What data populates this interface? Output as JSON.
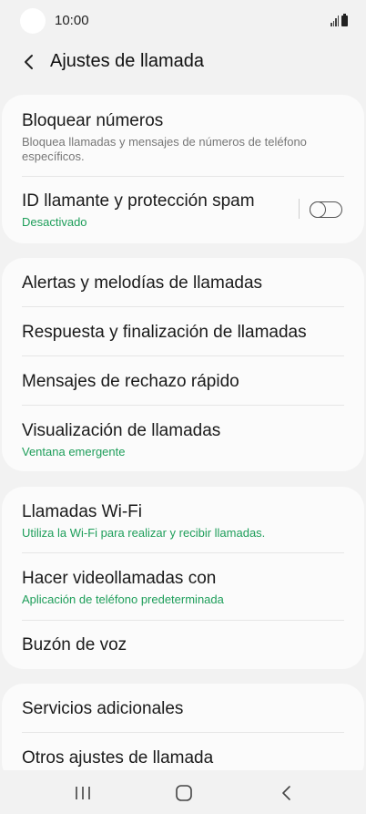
{
  "status": {
    "time": "10:00"
  },
  "header": {
    "title": "Ajustes de llamada"
  },
  "groups": [
    {
      "items": [
        {
          "title": "Bloquear números",
          "subtitle": "Bloquea llamadas y mensajes de números de teléfono específicos."
        },
        {
          "title": "ID llamante y protección spam",
          "subtitle": "Desactivado",
          "toggle": "off"
        }
      ]
    },
    {
      "items": [
        {
          "title": "Alertas y melodías de llamadas"
        },
        {
          "title": "Respuesta y finalización de llamadas"
        },
        {
          "title": "Mensajes de rechazo rápido"
        },
        {
          "title": "Visualización de llamadas",
          "subtitle": "Ventana emergente"
        }
      ]
    },
    {
      "items": [
        {
          "title": "Llamadas Wi-Fi",
          "subtitle": "Utiliza la Wi-Fi para realizar y recibir llamadas."
        },
        {
          "title": "Hacer videollamadas con",
          "subtitle": "Aplicación de teléfono predeterminada"
        },
        {
          "title": "Buzón de voz"
        }
      ]
    },
    {
      "items": [
        {
          "title": "Servicios adicionales"
        },
        {
          "title": "Otros ajustes de llamada"
        }
      ]
    }
  ],
  "colors": {
    "accent_green": "#1e9e5a",
    "background": "#f2f2f2",
    "card": "#fbfbfb"
  },
  "navbar": {
    "icons": [
      "recent-apps-icon",
      "home-icon",
      "back-icon"
    ]
  }
}
